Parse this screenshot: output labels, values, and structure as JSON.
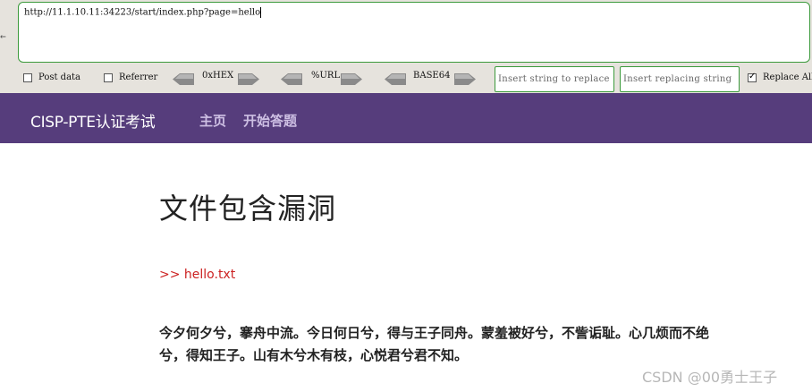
{
  "hackbar": {
    "url": "http://11.1.10.11:34223/start/index.php?page=hello",
    "post_data_label": "Post data",
    "referrer_label": "Referrer",
    "hex_label": "0xHEX",
    "url_label": "%URL",
    "base64_label": "BASE64",
    "find_placeholder": "Insert string to replace",
    "replace_placeholder": "Insert replacing string",
    "replace_all_label": "Replace All",
    "post_data_checked": false,
    "referrer_checked": false,
    "replace_all_checked": true
  },
  "navbar": {
    "brand": "CISP-PTE认证考试",
    "links": [
      "主页",
      "开始答题"
    ],
    "background": "#563d7c"
  },
  "main": {
    "title": "文件包含漏洞",
    "file_line": ">> hello.txt",
    "poem": "今夕何夕兮，搴舟中流。今日何日兮，得与王子同舟。蒙羞被好兮，不訾诟耻。心几烦而不绝兮，得知王子。山有木兮木有枝，心悦君兮君不知。"
  },
  "watermark": "CSDN @00勇士王子"
}
